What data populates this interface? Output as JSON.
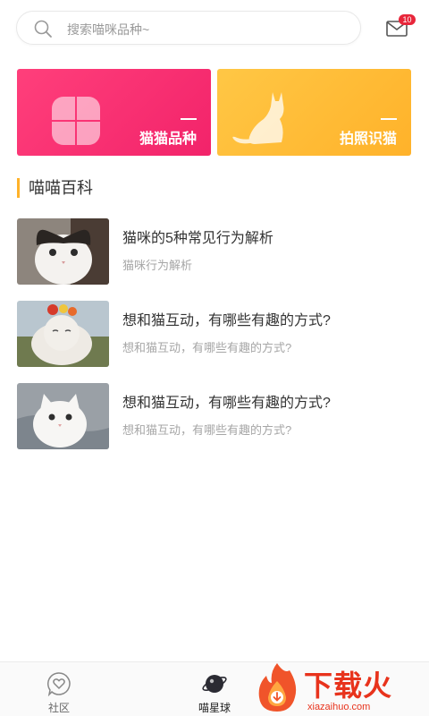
{
  "search": {
    "placeholder": "搜索喵咪品种~"
  },
  "messages": {
    "badge_count": "10"
  },
  "cards": [
    {
      "label": "猫猫品种",
      "color": "#f2236a"
    },
    {
      "label": "拍照识猫",
      "color": "#ffb22a"
    }
  ],
  "section": {
    "title": "喵喵百科",
    "accent": "#ffb22a"
  },
  "articles": [
    {
      "title": "猫咪的5种常见行为解析",
      "subtitle": "猫咪行为解析"
    },
    {
      "title": "想和猫互动，有哪些有趣的方式?",
      "subtitle": "想和猫互动，有哪些有趣的方式?"
    },
    {
      "title": "想和猫互动，有哪些有趣的方式?",
      "subtitle": "想和猫互动，有哪些有趣的方式?"
    }
  ],
  "tabbar": {
    "tabs": [
      {
        "label": "社区",
        "icon": "heart-chat-icon"
      },
      {
        "label": "喵星球",
        "icon": "planet-icon",
        "active": true
      }
    ]
  },
  "watermark": {
    "text": "下载火",
    "url": "xiazaihuo.com"
  }
}
